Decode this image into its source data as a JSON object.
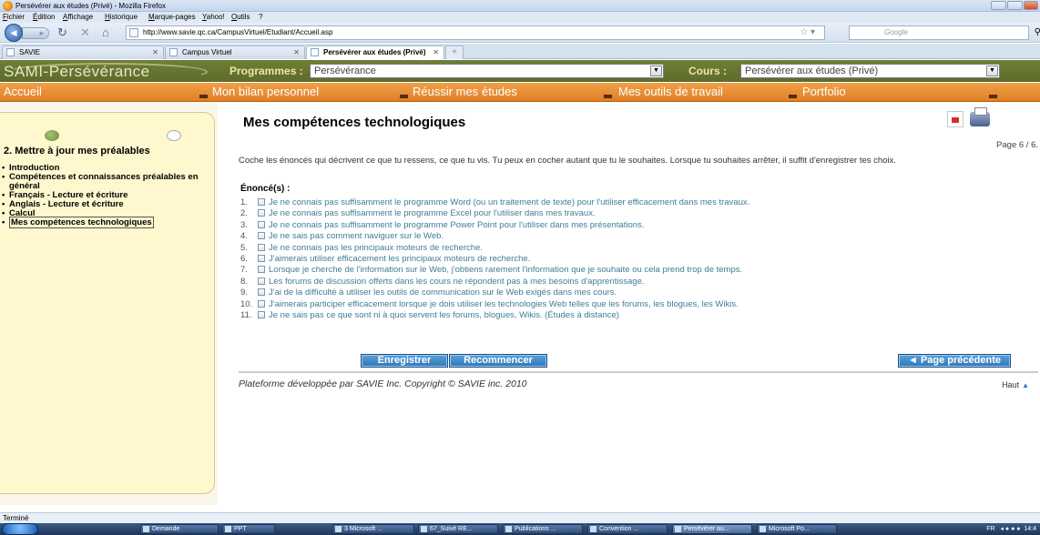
{
  "browser": {
    "title": "Persévérer aux études (Privé) - Mozilla Firefox",
    "menu": [
      "Fichier",
      "Édition",
      "Affichage",
      "Historique",
      "Marque-pages",
      "Yahoo!",
      "Outils",
      "?"
    ],
    "url": "http://www.savie.qc.ca/CampusVirtuel/Etudiant/Accueil.asp",
    "search_placeholder": "Google",
    "tabs": [
      {
        "label": "SAVIE",
        "active": false
      },
      {
        "label": "Campus Virtuel",
        "active": false
      },
      {
        "label": "Persévérer aux études (Privé)",
        "active": true
      }
    ],
    "status": "Terminé"
  },
  "site": {
    "logo": "SAMI-Persévérance",
    "programmes_label": "Programmes :",
    "programmes_value": "Persévérance",
    "cours_label": "Cours :",
    "cours_value": "Persévérer aux études (Privé)",
    "nav": [
      "Accueil",
      "Mon bilan personnel",
      "Réussir mes études",
      "Mes outils de travail",
      "Portfolio"
    ]
  },
  "sidebar": {
    "step_title": "2. Mettre à jour mes préalables",
    "items": [
      {
        "label": "Introduction",
        "current": false
      },
      {
        "label": "Compétences et connaissances préalables en général",
        "current": false
      },
      {
        "label": "Français - Lecture et écriture",
        "current": false
      },
      {
        "label": "Anglais - Lecture et écriture",
        "current": false
      },
      {
        "label": "Calcul",
        "current": false
      },
      {
        "label": "Mes compétences technologiques",
        "current": true
      }
    ]
  },
  "main": {
    "title": "Mes compétences technologiques",
    "page_info": "Page 6 / 6.",
    "instructions": "Coche les énoncés qui décrivent ce que tu ressens, ce que tu vis. Tu peux en cocher autant que tu le souhaites. Lorsque tu souhaites arrêter,  il suffit d'enregistrer tes choix.",
    "enonces_title": "Énoncé(s) :",
    "enonces": [
      "Je ne connais pas suffisamment le programme Word (ou un traitement de texte) pour l'utiliser efficacement dans mes travaux.",
      "Je ne connais pas suffisamment le programme Excel pour l'utiliser dans mes travaux.",
      "Je ne connais pas suffisamment le programme Power Point pour l'utiliser dans mes présentations.",
      "Je ne sais pas comment naviguer sur le Web.",
      "Je ne connais pas les principaux moteurs de recherche.",
      "J'aimerais utiliser efficacement les principaux moteurs de recherche.",
      "Lorsque je cherche de l'information sur le Web, j'obtiens rarement l'information que je souhaite ou cela prend trop de temps.",
      "Les forums de discussion offerts dans les cours ne répondent pas à mes besoins d'apprentissage.",
      "J'ai de la difficulté à utiliser les outils de communication sur le Web exigés dans mes cours.",
      "J'aimerais participer efficacement lorsque je dois utiliser les technologies Web telles que les forums, les blogues, les Wikis.",
      "Je ne sais pas ce que sont ni à quoi servent les forums, blogues, Wikis. (Études à distance)"
    ],
    "buttons": {
      "save": "Enregistrer",
      "reset": "Recommencer",
      "previous": "◄ Page précédente"
    },
    "footer": "Plateforme développée par SAVIE Inc. Copyright © SAVIE inc. 2010",
    "top_link": "Haut"
  },
  "taskbar": {
    "items": [
      "Demande",
      "PPT",
      "3 Microsoft ...",
      "67_Suivé RE...",
      "Publications ...",
      "Convention ...",
      "Persévérer au...",
      "Microsoft Po..."
    ],
    "lang": "FR",
    "clock": "14:4"
  }
}
